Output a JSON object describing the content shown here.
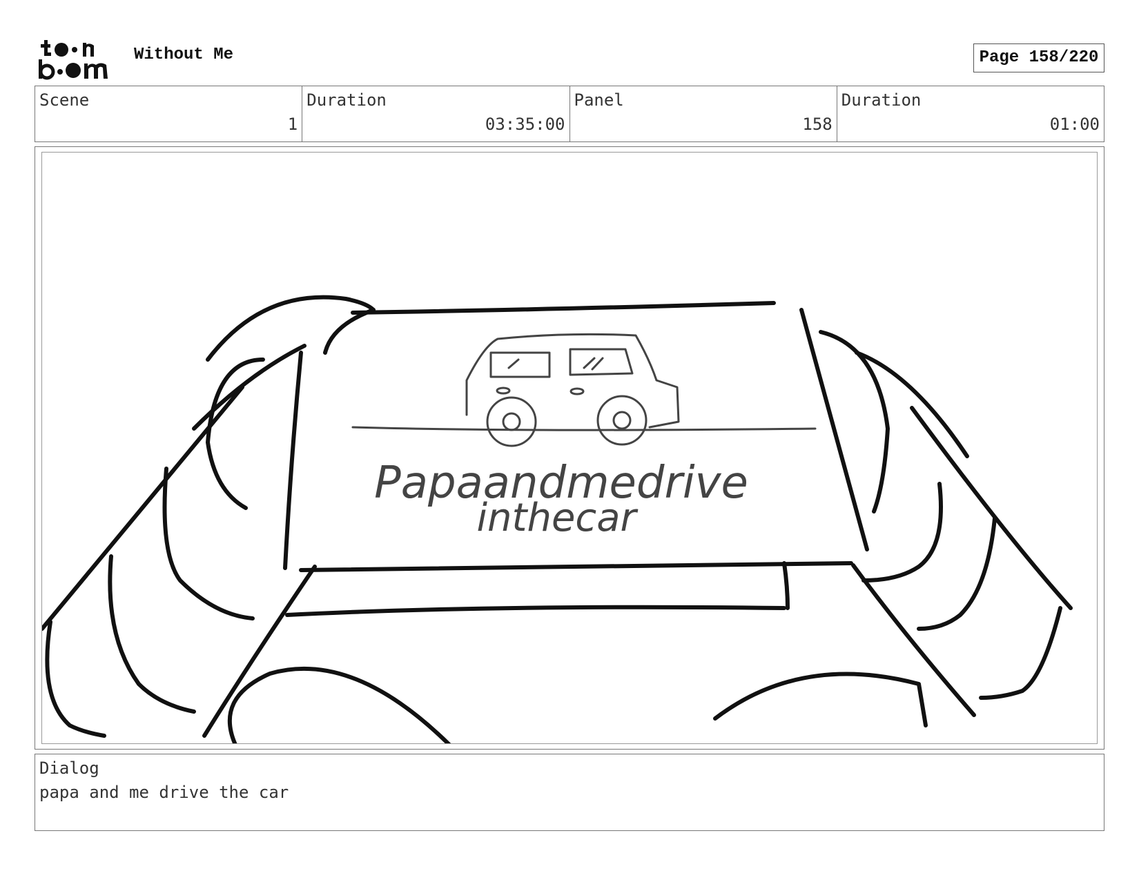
{
  "header": {
    "logo_text": "toon boom",
    "title": "Without Me",
    "page_label": "Page 158/220"
  },
  "info": {
    "scene_label": "Scene",
    "scene_value": "1",
    "scene_duration_label": "Duration",
    "scene_duration_value": "03:35:00",
    "panel_label": "Panel",
    "panel_value": "158",
    "panel_duration_label": "Duration",
    "panel_duration_value": "01:00"
  },
  "panel": {
    "sign_line1": "Papaandmedrive",
    "sign_line2": "inthecar"
  },
  "dialog": {
    "label": "Dialog",
    "text": "papa and me drive the car"
  }
}
